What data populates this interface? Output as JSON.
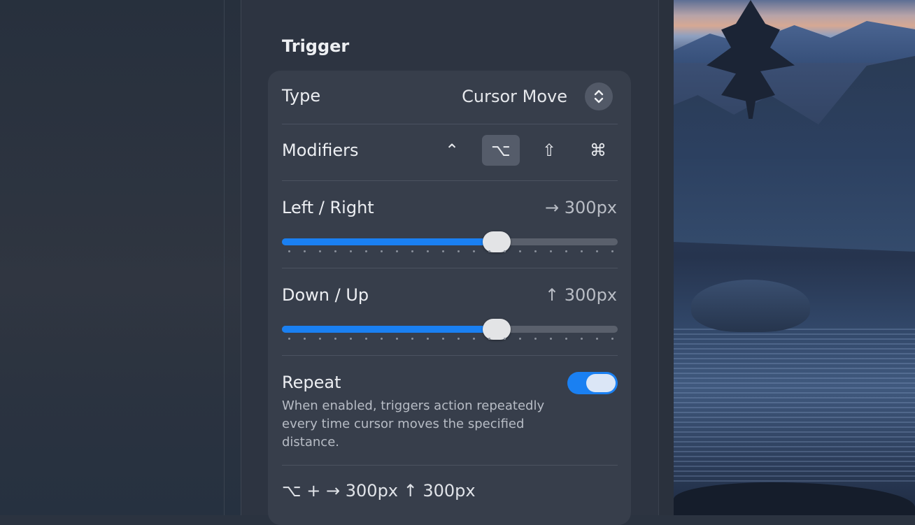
{
  "section": {
    "title": "Trigger"
  },
  "type_row": {
    "label": "Type",
    "value": "Cursor Move"
  },
  "modifiers": {
    "label": "Modifiers",
    "keys": [
      {
        "symbol": "⌃",
        "name": "control",
        "active": false
      },
      {
        "symbol": "⌥",
        "name": "option",
        "active": true
      },
      {
        "symbol": "⇧",
        "name": "shift",
        "active": false
      },
      {
        "symbol": "⌘",
        "name": "command",
        "active": false
      }
    ]
  },
  "left_right": {
    "label": "Left / Right",
    "value": "→ 300px",
    "fraction": 0.64
  },
  "down_up": {
    "label": "Down / Up",
    "value": "↑ 300px",
    "fraction": 0.64
  },
  "repeat": {
    "label": "Repeat",
    "enabled": true,
    "description": "When enabled, triggers action repeatedly every time cursor moves the specified distance."
  },
  "summary": "⌥ + → 300px ↑ 300px",
  "colors": {
    "accent": "#1a80f2",
    "panel": "#2d3441",
    "card": "#373e4b"
  }
}
